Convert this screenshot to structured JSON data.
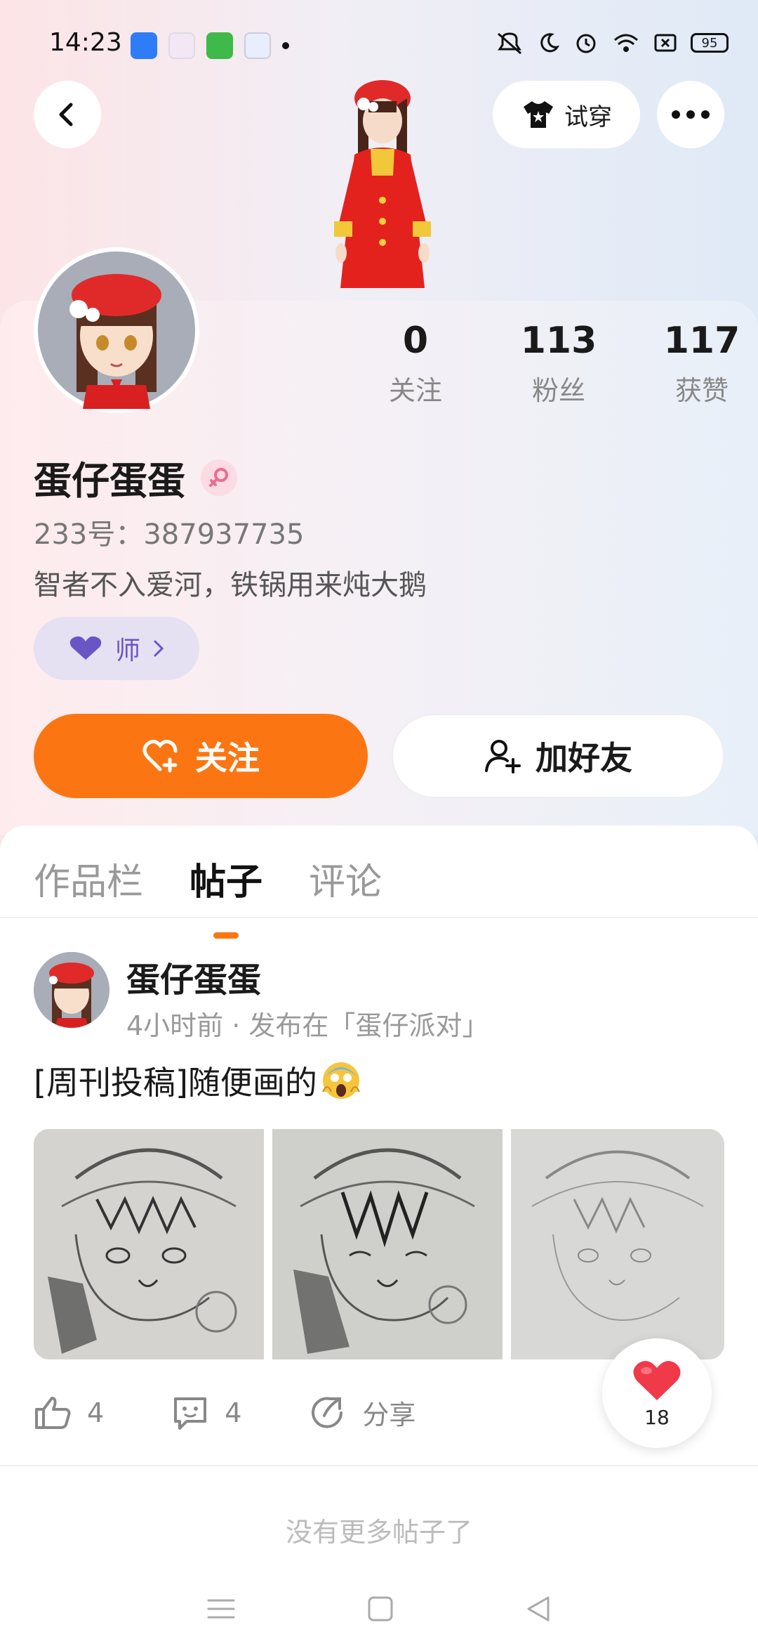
{
  "status_bar": {
    "time": "14:23",
    "battery": "95"
  },
  "header": {
    "tryon_label": "试穿"
  },
  "stats": [
    {
      "value": "0",
      "label": "关注"
    },
    {
      "value": "113",
      "label": "粉丝"
    },
    {
      "value": "117",
      "label": "获赞"
    }
  ],
  "profile": {
    "name": "蛋仔蛋蛋",
    "uid": "233号：387937735",
    "bio": "智者不入爱河，铁锅用来炖大鹅",
    "badge_label": "师"
  },
  "buttons": {
    "follow": "关注",
    "add_friend": "加好友"
  },
  "tabs": [
    {
      "label": "作品栏",
      "active": false
    },
    {
      "label": "帖子",
      "active": true
    },
    {
      "label": "评论",
      "active": false
    }
  ],
  "post": {
    "author": "蛋仔蛋蛋",
    "meta": "4小时前 · 发布在「蛋仔派对」",
    "text": "[周刊投稿]随便画的",
    "likes": "4",
    "comments": "4",
    "share_label": "分享"
  },
  "floating_like_count": "18",
  "footer": {
    "no_more": "没有更多帖子了"
  },
  "colors": {
    "accent": "#fb7612",
    "badge_bg": "#e6e0f3",
    "badge_text": "#6a55c4"
  }
}
